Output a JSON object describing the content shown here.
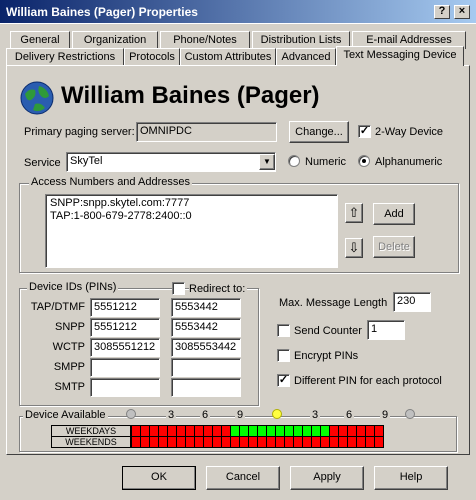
{
  "window": {
    "title": "William Baines (Pager) Properties",
    "close_label": "×",
    "help_label": "?"
  },
  "tabs_row1": [
    "General",
    "Organization",
    "Phone/Notes",
    "Distribution Lists",
    "E-mail Addresses"
  ],
  "tabs_row2": [
    "Delivery Restrictions",
    "Protocols",
    "Custom Attributes",
    "Advanced",
    "Text Messaging Device"
  ],
  "header": {
    "name": "William Baines (Pager)"
  },
  "paging": {
    "server_label": "Primary paging server:",
    "server_value": "OMNIPDC",
    "change_label": "Change...",
    "two_way_label": "2-Way Device",
    "two_way_checked": true
  },
  "service": {
    "label": "Service",
    "value": "SkyTel",
    "numeric_label": "Numeric",
    "alphanumeric_label": "Alphanumeric",
    "selected": "Alphanumeric"
  },
  "access": {
    "title": "Access Numbers and Addresses",
    "entries": [
      "SNPP:snpp.skytel.com:7777",
      "TAP:1-800-679-2778:2400::0"
    ],
    "add_label": "Add",
    "delete_label": "Delete"
  },
  "device_ids": {
    "title": "Device IDs (PINs)",
    "redirect_label": "Redirect to:",
    "rows": [
      {
        "label": "TAP/DTMF",
        "pin": "5551212",
        "redirect": "5553442"
      },
      {
        "label": "SNPP",
        "pin": "5551212",
        "redirect": "5553442"
      },
      {
        "label": "WCTP",
        "pin": "3085551212",
        "redirect": "3085553442"
      },
      {
        "label": "SMPP",
        "pin": "",
        "redirect": ""
      },
      {
        "label": "SMTP",
        "pin": "",
        "redirect": ""
      }
    ]
  },
  "options": {
    "max_length_label": "Max. Message Length",
    "max_length_value": "230",
    "send_counter_label": "Send Counter",
    "send_counter_value": "1",
    "encrypt_label": "Encrypt PINs",
    "different_pin_label": "Different PIN for each protocol",
    "different_pin_checked": true
  },
  "availability": {
    "title": "Device Available",
    "hour_ticks": [
      "3",
      "6",
      "9",
      "3",
      "6",
      "9"
    ],
    "weekdays_label": "WEEKDAYS",
    "weekends_label": "WEEKENDS",
    "weekdays": [
      0,
      0,
      0,
      0,
      0,
      0,
      0,
      0,
      0,
      0,
      0,
      1,
      1,
      1,
      1,
      1,
      1,
      1,
      1,
      1,
      1,
      1,
      0,
      0,
      0,
      0,
      0,
      0
    ],
    "weekends": [
      0,
      0,
      0,
      0,
      0,
      0,
      0,
      0,
      0,
      0,
      0,
      0,
      0,
      0,
      0,
      0,
      0,
      0,
      0,
      0,
      0,
      0,
      0,
      0,
      0,
      0,
      0,
      0
    ],
    "on_color": "#00ff00",
    "off_color": "#ff0000"
  },
  "footer": {
    "ok": "OK",
    "cancel": "Cancel",
    "apply": "Apply",
    "help": "Help"
  }
}
